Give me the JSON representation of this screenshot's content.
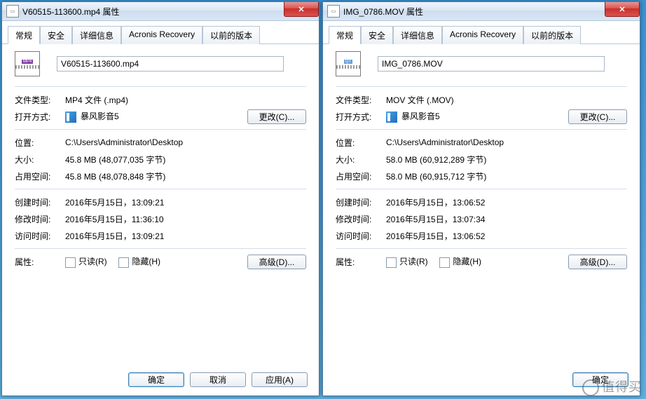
{
  "tabs": [
    "常规",
    "安全",
    "详细信息",
    "Acronis Recovery",
    "以前的版本"
  ],
  "labels": {
    "filetype": "文件类型:",
    "openwith": "打开方式:",
    "location": "位置:",
    "size": "大小:",
    "ondisk": "占用空间:",
    "created": "创建时间:",
    "modified": "修改时间:",
    "accessed": "访问时间:",
    "attributes": "属性:",
    "readonly": "只读(R)",
    "hidden": "隐藏(H)",
    "change": "更改(C)...",
    "advanced": "高级(D)...",
    "ok": "确定",
    "cancel": "取消",
    "apply": "应用(A)"
  },
  "openWithApp": "暴风影音5",
  "dialogs": [
    {
      "title": "V60515-113600.mp4 属性",
      "filename": "V60515-113600.mp4",
      "iconTag": "MP4",
      "iconClass": "",
      "filetype": "MP4 文件 (.mp4)",
      "location": "C:\\Users\\Administrator\\Desktop",
      "size": "45.8 MB (48,077,035 字节)",
      "ondisk": "45.8 MB (48,078,848 字节)",
      "created": "2016年5月15日，13:09:21",
      "modified": "2016年5月15日，11:36:10",
      "accessed": "2016年5月15日，13:09:21",
      "buttons": [
        "ok",
        "cancel",
        "apply"
      ]
    },
    {
      "title": "IMG_0786.MOV 属性",
      "filename": "IMG_0786.MOV",
      "iconTag": "QT",
      "iconClass": "qt",
      "filetype": "MOV 文件 (.MOV)",
      "location": "C:\\Users\\Administrator\\Desktop",
      "size": "58.0 MB (60,912,289 字节)",
      "ondisk": "58.0 MB (60,915,712 字节)",
      "created": "2016年5月15日，13:06:52",
      "modified": "2016年5月15日，13:07:34",
      "accessed": "2016年5月15日，13:06:52",
      "buttons": [
        "ok"
      ]
    }
  ],
  "watermark": "值得买"
}
